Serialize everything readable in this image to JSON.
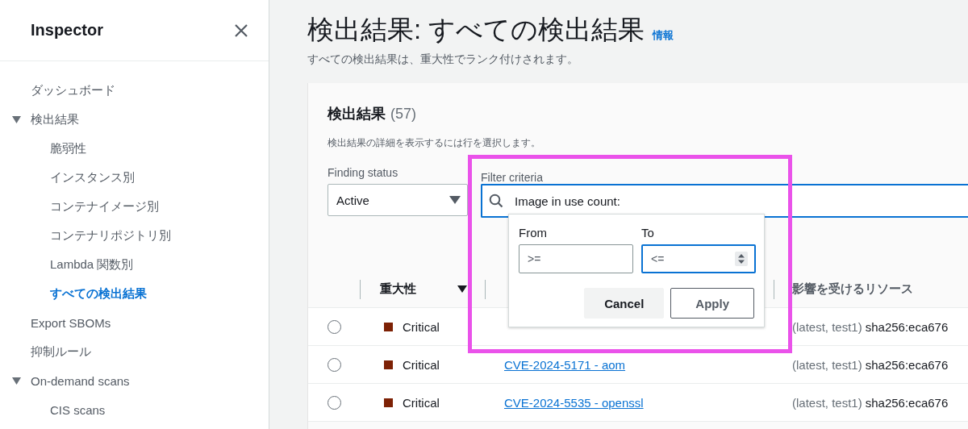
{
  "sidebar": {
    "title": "Inspector",
    "items": [
      {
        "label": "ダッシュボード",
        "selected": false
      },
      {
        "label": "検出結果",
        "expanded": true,
        "selected": false,
        "children": [
          {
            "label": "脆弱性",
            "selected": false
          },
          {
            "label": "インスタンス別",
            "selected": false
          },
          {
            "label": "コンテナイメージ別",
            "selected": false
          },
          {
            "label": "コンテナリポジトリ別",
            "selected": false
          },
          {
            "label": "Lambda 関数別",
            "selected": false
          },
          {
            "label": "すべての検出結果",
            "selected": true
          }
        ]
      },
      {
        "label": "Export SBOMs",
        "selected": false
      },
      {
        "label": "抑制ルール",
        "selected": false
      },
      {
        "label": "On-demand scans",
        "expanded": true,
        "selected": false,
        "children": [
          {
            "label": "CIS scans",
            "selected": false
          }
        ]
      }
    ]
  },
  "page": {
    "title": "検出結果: すべての検出結果",
    "info_link": "情報",
    "description": "すべての検出結果は、重大性でランク付けされます。"
  },
  "findings": {
    "heading": "検出結果",
    "count": "(57)",
    "description": "検出結果の詳細を表示するには行を選択します。",
    "status_filter": {
      "label": "Finding status",
      "value": "Active"
    },
    "filter": {
      "label": "Filter criteria",
      "value": "Image in use count:"
    },
    "range_popover": {
      "from": {
        "label": "From",
        "placeholder": ">=",
        "focused": false
      },
      "to": {
        "label": "To",
        "placeholder": "<=",
        "focused": true
      },
      "buttons": [
        {
          "label": "Cancel",
          "kind": "secondary"
        },
        {
          "label": "Apply",
          "kind": "outline"
        }
      ]
    },
    "table": {
      "columns": [
        {
          "label": "重大性",
          "sorted": true
        },
        {
          "label": "影響を受けるリソース"
        }
      ],
      "rows": [
        {
          "selected": false,
          "severity": "Critical",
          "color": "#7d2105",
          "resource_tags": "(latest, test1)",
          "resource": "sha256:eca676"
        },
        {
          "selected": false,
          "severity": "Critical",
          "color": "#7d2105",
          "title": "CVE-2024-5171 - aom",
          "resource_tags": "(latest, test1)",
          "resource": "sha256:eca676"
        },
        {
          "selected": false,
          "severity": "Critical",
          "color": "#7d2105",
          "title": "CVE-2024-5535 - openssl",
          "resource_tags": "(latest, test1)",
          "resource": "sha256:eca676"
        }
      ]
    }
  }
}
